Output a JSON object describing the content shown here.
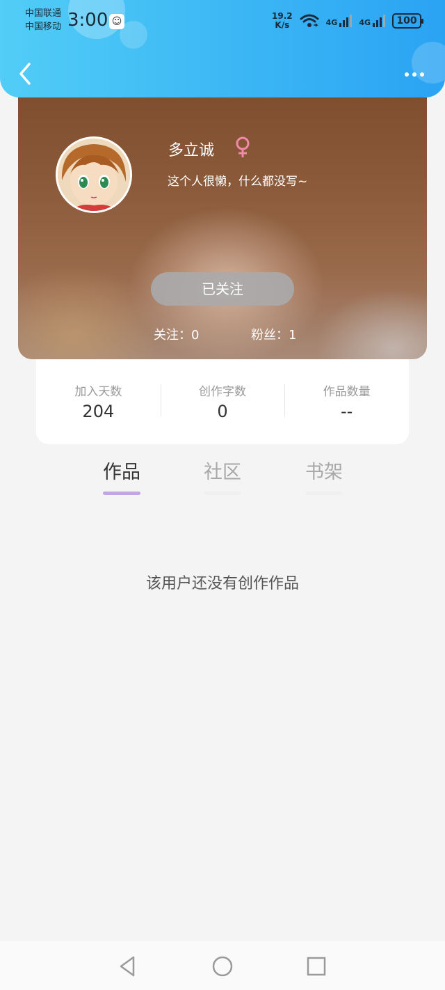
{
  "status": {
    "carrier1": "中国联通",
    "carrier2": "中国移动",
    "time": "3:00",
    "speed_value": "19.2",
    "speed_unit": "K/s",
    "net1": "4G",
    "net2": "4G",
    "battery": "100"
  },
  "header": {
    "back_icon": "chevron-left-icon",
    "more_icon": "more-dots-icon"
  },
  "profile": {
    "name": "多立诚",
    "gender_icon": "female-symbol-icon",
    "gender_color": "#f08aa8",
    "bio": "这个人很懒，什么都没写~",
    "follow_button": "已关注",
    "following_label": "关注：0",
    "followers_label": "粉丝：1"
  },
  "stats": [
    {
      "label": "加入天数",
      "value": "204"
    },
    {
      "label": "创作字数",
      "value": "0"
    },
    {
      "label": "作品数量",
      "value": "--"
    }
  ],
  "tabs": [
    {
      "label": "作品",
      "active": true
    },
    {
      "label": "社区",
      "active": false
    },
    {
      "label": "书架",
      "active": false
    }
  ],
  "empty_message": "该用户还没有创作作品",
  "navbar": {
    "back": "triangle-back-icon",
    "home": "circle-home-icon",
    "recents": "square-recents-icon"
  },
  "colors": {
    "header_accent": "#3bb6f4",
    "tab_indicator": "#c3a6e3"
  }
}
